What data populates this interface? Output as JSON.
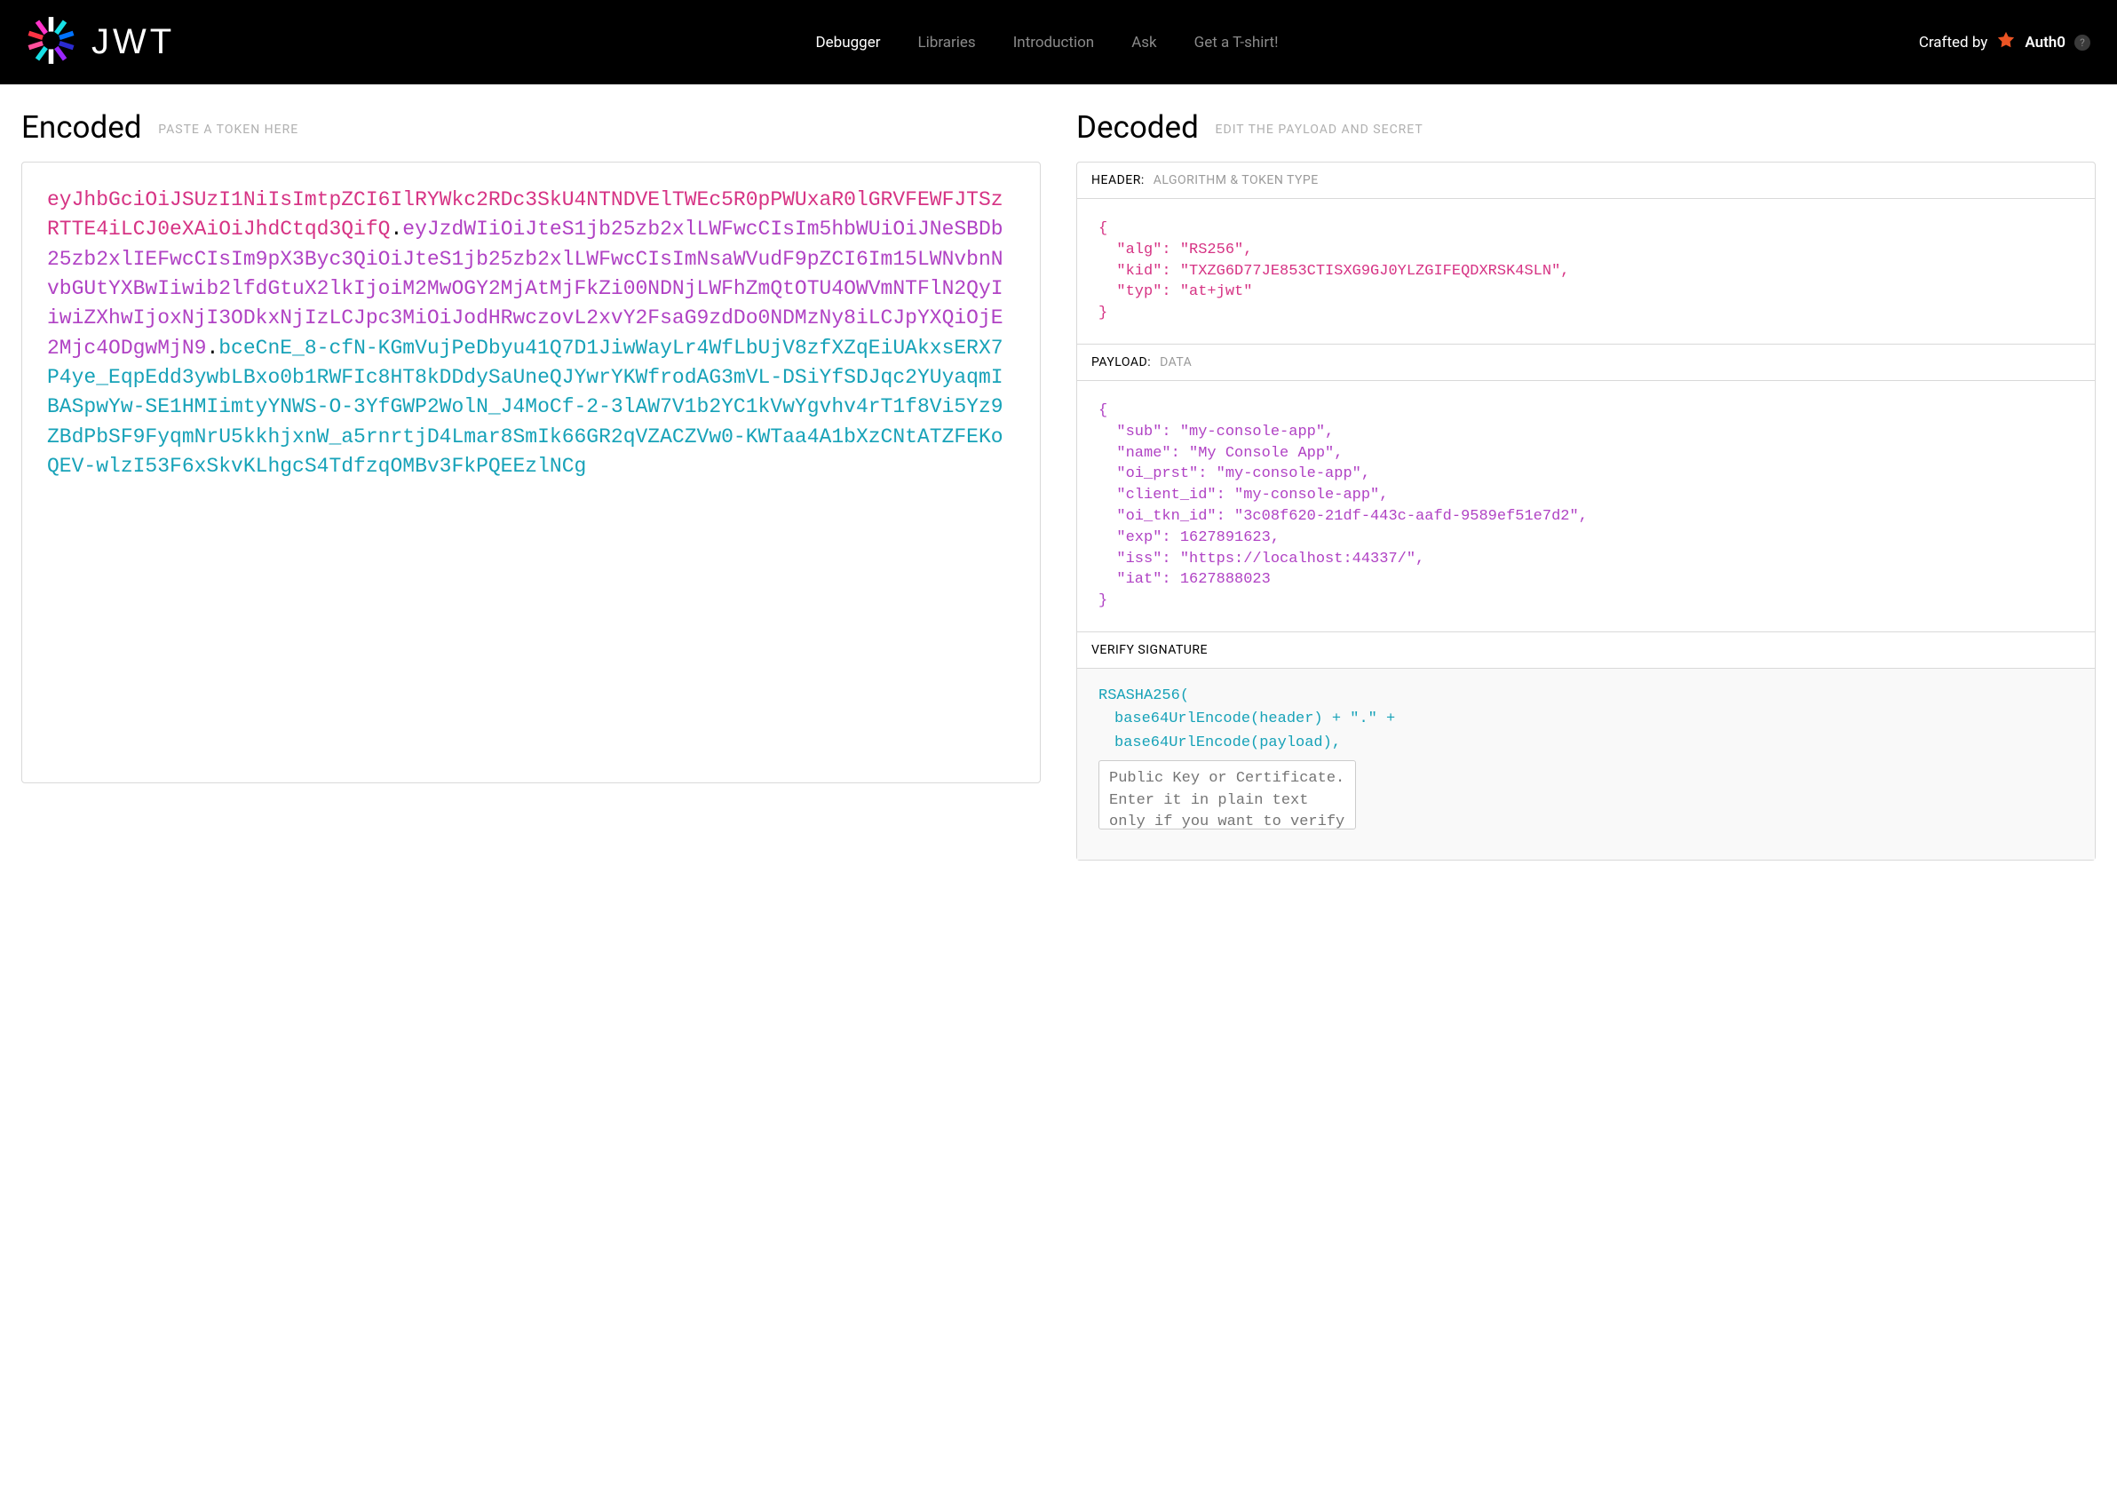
{
  "header": {
    "brand": "JWT",
    "nav": {
      "debugger": "Debugger",
      "libraries": "Libraries",
      "introduction": "Introduction",
      "ask": "Ask",
      "tshirt": "Get a T-shirt!"
    },
    "crafted_by": "Crafted by",
    "auth0": "Auth0",
    "help_glyph": "?"
  },
  "encoded": {
    "title": "Encoded",
    "subtitle": "PASTE A TOKEN HERE",
    "token_header": "eyJhbGciOiJSUzI1NiIsImtpZCI6IlRYWkc2RDc3SkU4NTNDVElTWEc5R0pPWUxaR0lGRVFEWFJTSzRTTE4iLCJ0eXAiOiJhdCtqd3QifQ",
    "dot1": ".",
    "token_payload": "eyJzdWIiOiJteS1jb25zb2xlLWFwcCIsIm5hbWUiOiJNeSBDb25zb2xlIEFwcCIsIm9pX3Byc3QiOiJteS1jb25zb2xlLWFwcCIsImNsaWVudF9pZCI6Im15LWNvbnNvbGUtYXBwIiwib2lfdGtuX2lkIjoiM2MwOGY2MjAtMjFkZi00NDNjLWFhZmQtOTU4OWVmNTFlN2QyIiwiZXhwIjoxNjI3ODkxNjIzLCJpc3MiOiJodHRwczovL2xvY2FsaG9zdDo0NDMzNy8iLCJpYXQiOjE2Mjc4ODgwMjN9",
    "dot2": ".",
    "token_signature": "bceCnE_8-cfN-KGmVujPeDbyu41Q7D1JiwWayLr4WfLbUjV8zfXZqEiUAkxsERX7P4ye_EqpEdd3ywbLBxo0b1RWFIc8HT8kDDdySaUneQJYwrYKWfrodAG3mVL-DSiYfSDJqc2YUyaqmIBASpwYw-SE1HMIimtyYNWS-O-3YfGWP2WolN_J4MoCf-2-3lAW7V1b2YC1kVwYgvhv4rT1f8Vi5Yz9ZBdPbSF9FyqmNrU5kkhjxnW_a5rnrtjD4Lmar8SmIk66GR2qVZACZVw0-KWTaa4A1bXzCNtATZFEKoQEV-wlzI53F6xSkvKLhgcS4TdfzqOMBv3FkPQEEzlNCg"
  },
  "decoded": {
    "title": "Decoded",
    "subtitle": "EDIT THE PAYLOAD AND SECRET",
    "header_section": {
      "label": "HEADER:",
      "hint": "ALGORITHM & TOKEN TYPE",
      "json": "{\n  \"alg\": \"RS256\",\n  \"kid\": \"TXZG6D77JE853CTISXG9GJ0YLZGIFEQDXRSK4SLN\",\n  \"typ\": \"at+jwt\"\n}"
    },
    "payload_section": {
      "label": "PAYLOAD:",
      "hint": "DATA",
      "json": "{\n  \"sub\": \"my-console-app\",\n  \"name\": \"My Console App\",\n  \"oi_prst\": \"my-console-app\",\n  \"client_id\": \"my-console-app\",\n  \"oi_tkn_id\": \"3c08f620-21df-443c-aafd-9589ef51e7d2\",\n  \"exp\": 1627891623,\n  \"iss\": \"https://localhost:44337/\",\n  \"iat\": 1627888023\n}"
    },
    "verify_section": {
      "label": "VERIFY SIGNATURE",
      "line1": "RSASHA256(",
      "line2": "base64UrlEncode(header) + \".\" +",
      "line3": "base64UrlEncode(payload),",
      "public_key_placeholder": "Public Key or Certificate. Enter it in plain text only if you want to verify a token"
    }
  }
}
